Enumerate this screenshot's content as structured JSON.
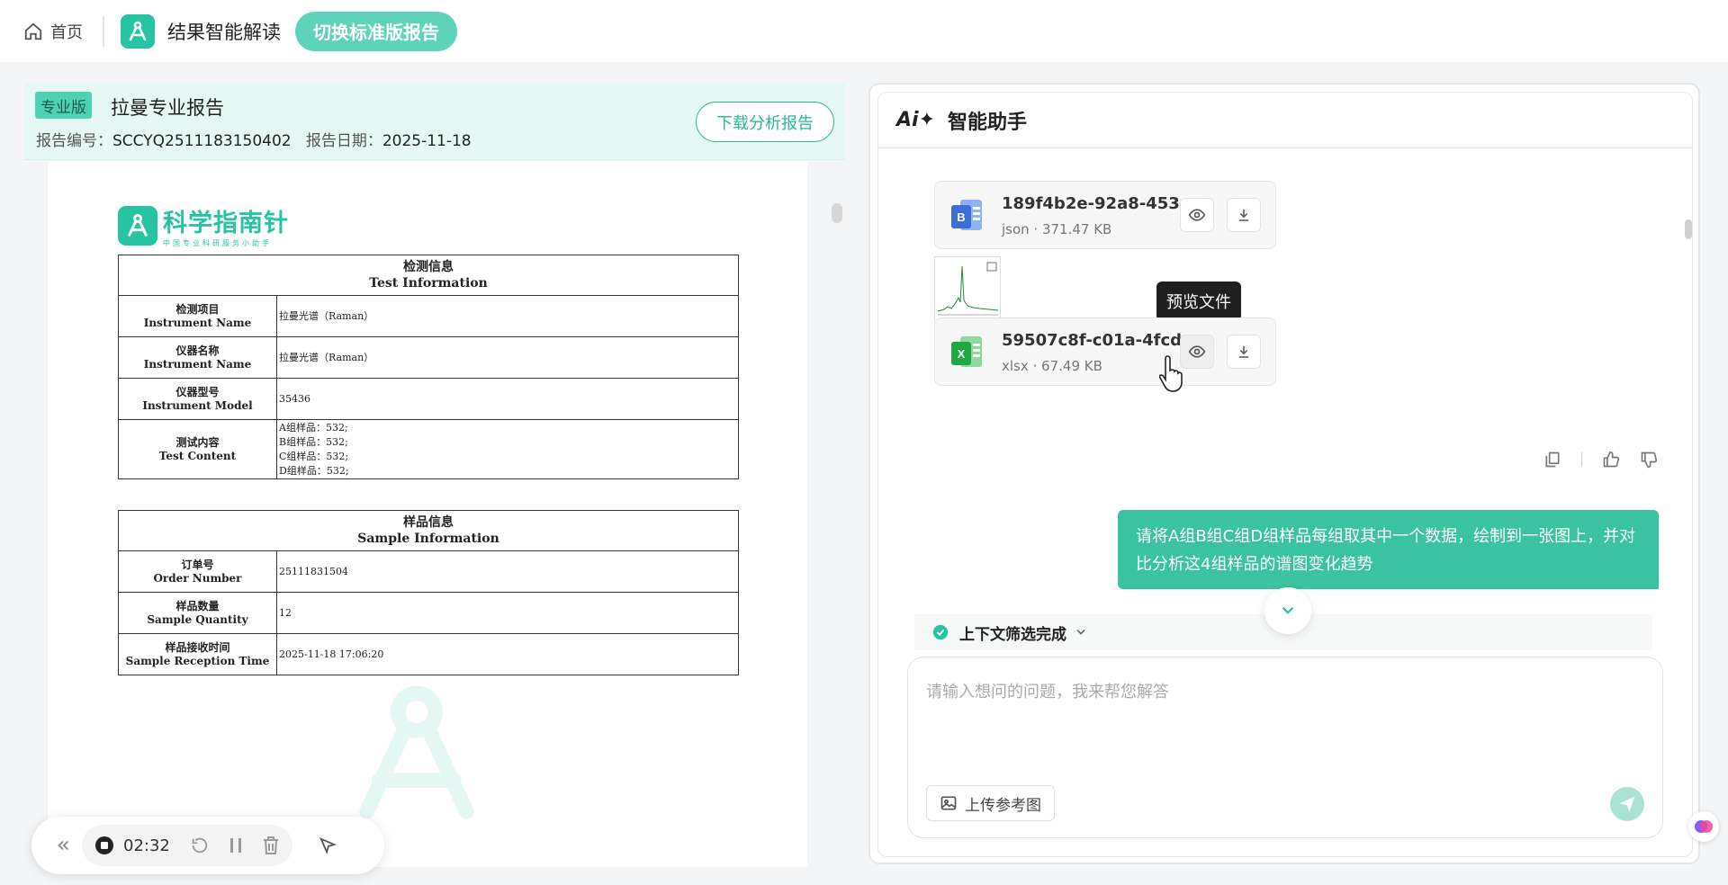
{
  "topbar": {
    "home_label": "首页",
    "app_title": "结果智能解读",
    "switch_label": "切换标准版报告"
  },
  "report": {
    "badge": "专业版",
    "title": "拉曼专业报告",
    "number_label": "报告编号：",
    "number": "SCCYQ2511183150402",
    "date_label": "报告日期：",
    "date": "2025-11-18",
    "download_label": "下载分析报告"
  },
  "doc": {
    "logo_name": "科学指南针",
    "logo_sub": "中国专业科研服务小助手",
    "test_info": {
      "title_cn": "检测信息",
      "title_en": "Test Information",
      "rows": [
        {
          "k_cn": "检测项目",
          "k_en": "Instrument Name",
          "v": "拉曼光谱（Raman）"
        },
        {
          "k_cn": "仪器名称",
          "k_en": "Instrument Name",
          "v": "拉曼光谱（Raman）"
        },
        {
          "k_cn": "仪器型号",
          "k_en": "Instrument Model",
          "v": "35436"
        }
      ],
      "content": {
        "k_cn": "测试内容",
        "k_en": "Test Content",
        "lines": [
          "A组样品：532;",
          "B组样品：532;",
          "C组样品：532;",
          "D组样品：532;"
        ]
      }
    },
    "sample_info": {
      "title_cn": "样品信息",
      "title_en": "Sample Information",
      "rows": [
        {
          "k_cn": "订单号",
          "k_en": "Order Number",
          "v": "25111831504"
        },
        {
          "k_cn": "样品数量",
          "k_en": "Sample Quantity",
          "v": "12"
        },
        {
          "k_cn": "样品接收时间",
          "k_en": "Sample Reception Time",
          "v": "2025-11-18 17:06:20"
        }
      ]
    }
  },
  "recorder": {
    "time": "02:32"
  },
  "assistant": {
    "ai_mark": "Ai✦",
    "title": "智能助手",
    "files": [
      {
        "name": "189f4b2e-92a8-453e...",
        "meta": "json · 371.47 KB",
        "icon": "word-doc-icon",
        "color": "#3b6fd6"
      },
      {
        "name": "59507c8f-c01a-4fcd-...",
        "meta": "xlsx · 67.49 KB",
        "icon": "excel-icon",
        "color": "#1fa843"
      }
    ],
    "tooltip": "预览文件",
    "user_message": "请将A组B组C组D组样品每组取其中一个数据，绘制到一张图上，并对比分析这4组样品的谱图变化趋势",
    "context_status": "上下文筛选完成",
    "input_placeholder": "请输入想问的问题，我来帮您解答",
    "upload_label": "上传参考图"
  },
  "colors": {
    "accent": "#27c4a4",
    "user_bubble": "#3bc3a1",
    "report_header_bg": "#e5f8f3"
  }
}
